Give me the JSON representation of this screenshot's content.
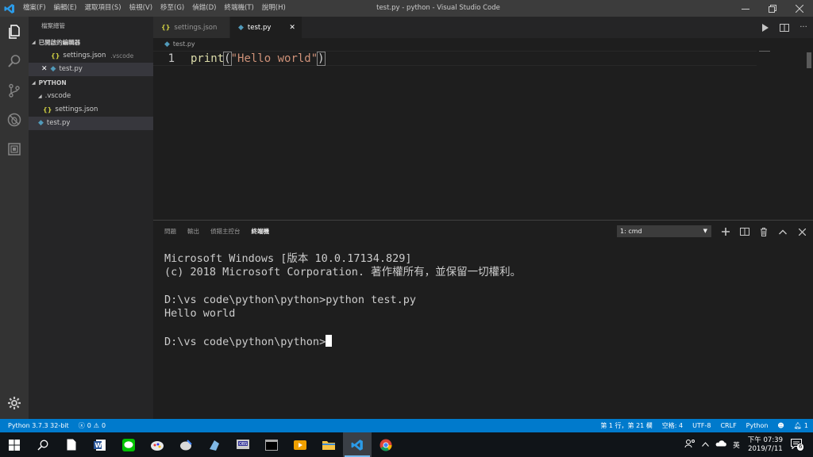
{
  "window": {
    "title": "test.py - python - Visual Studio Code",
    "menu": [
      "檔案(F)",
      "編輯(E)",
      "選取項目(S)",
      "檢視(V)",
      "移至(G)",
      "偵錯(D)",
      "終端機(T)",
      "說明(H)"
    ]
  },
  "sidebar": {
    "title": "檔案總管",
    "open_editors_header": "已開啟的編輯器",
    "open_editors": [
      {
        "name": "settings.json",
        "folder": ".vscode"
      },
      {
        "name": "test.py",
        "folder": ""
      }
    ],
    "project_header": "PYTHON",
    "tree": [
      ".vscode",
      "settings.json",
      "test.py"
    ]
  },
  "tabs": [
    {
      "label": "settings.json",
      "active": false
    },
    {
      "label": "test.py",
      "active": true
    }
  ],
  "breadcrumb": "test.py",
  "editor": {
    "line_number": "1",
    "code": {
      "fn": "print",
      "open": "(",
      "str": "\"Hello world\"",
      "close": ")"
    }
  },
  "panel": {
    "tabs": [
      "問題",
      "輸出",
      "偵錯主控台",
      "終端機"
    ],
    "active_tab": "終端機",
    "terminal_select": "1: cmd",
    "terminal_lines": [
      "Microsoft Windows [版本 10.0.17134.829]",
      "(c) 2018 Microsoft Corporation. 著作權所有，並保留一切權利。",
      "",
      "D:\\vs code\\python\\python>python test.py",
      "Hello world",
      "",
      "D:\\vs code\\python\\python>"
    ]
  },
  "statusbar": {
    "interpreter": "Python 3.7.3 32-bit",
    "errors": "0",
    "warnings": "0",
    "position": "第 1 行，第 21 欄",
    "spaces": "空格: 4",
    "encoding": "UTF-8",
    "eol": "CRLF",
    "language": "Python",
    "notifications": "1"
  },
  "taskbar": {
    "ime": "英",
    "time": "下午 07:39",
    "date": "2019/7/11",
    "notification_count": "6"
  },
  "colors": {
    "accent": "#007acc",
    "editor_bg": "#1e1e1e",
    "sidebar_bg": "#252526",
    "activity_bg": "#333333",
    "string": "#ce9178",
    "function": "#dcdcaa"
  }
}
